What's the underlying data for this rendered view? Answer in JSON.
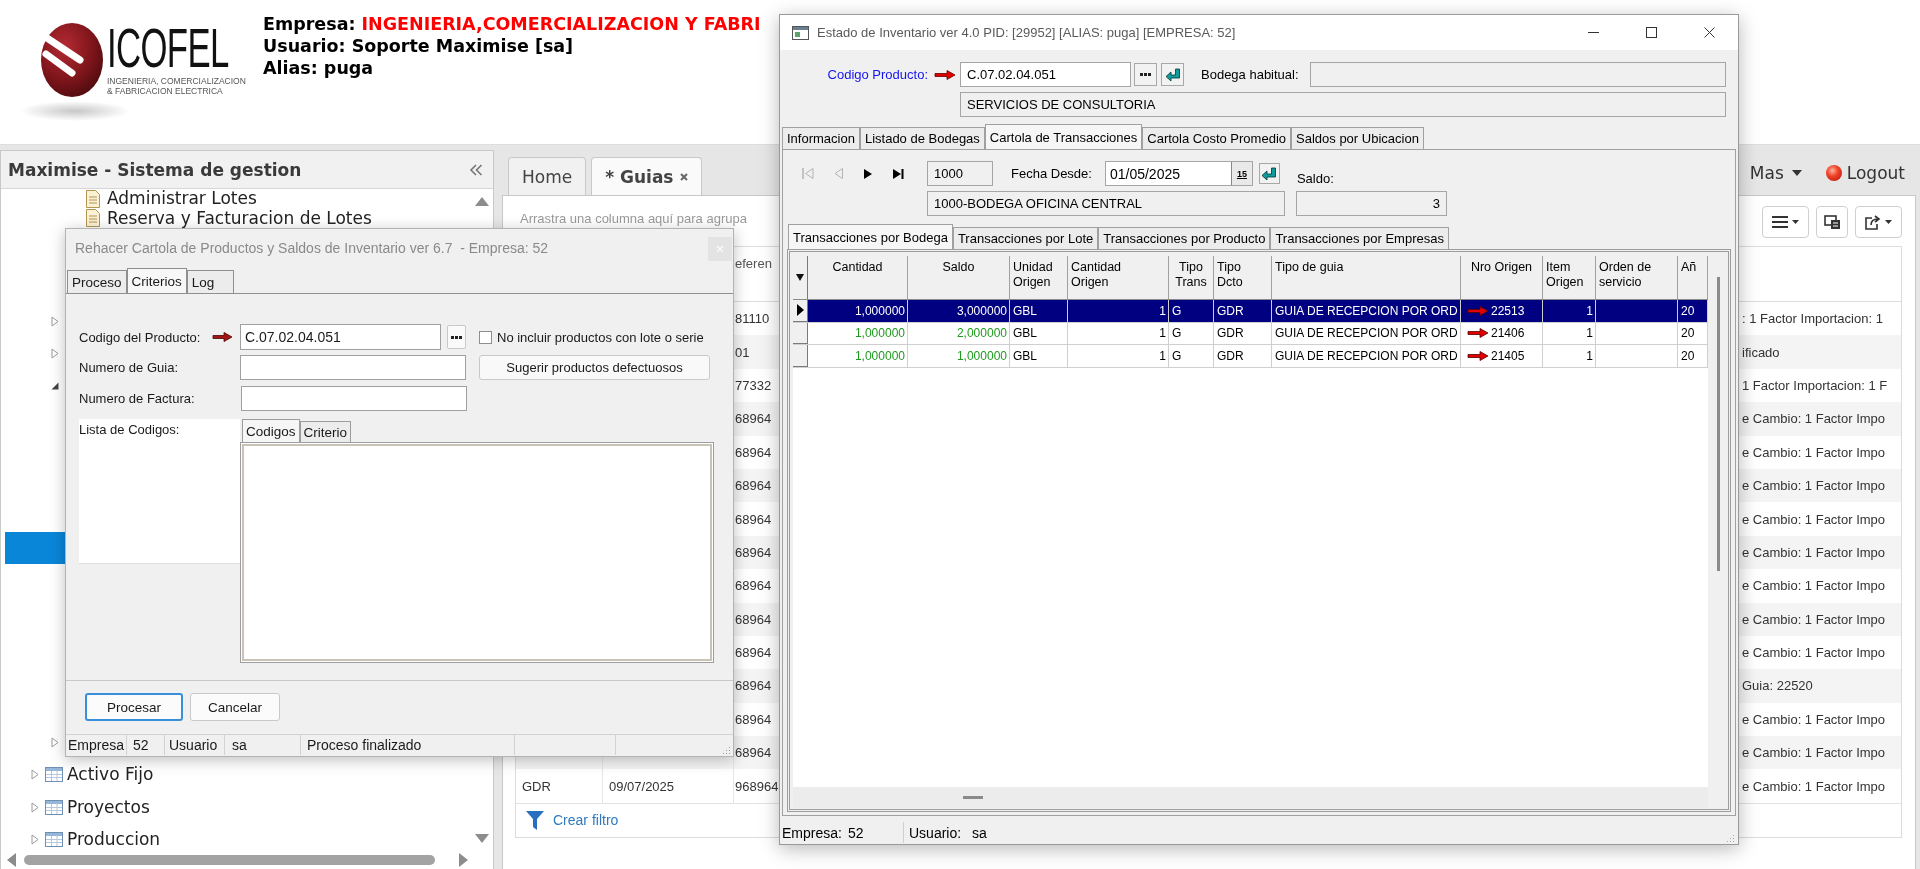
{
  "header": {
    "logo": {
      "name": "ICOFEL",
      "tagline": [
        "INGENIERIA, COMERCIALIZACION",
        "& FABRICACION ELECTRICA"
      ]
    },
    "lines": [
      {
        "label": "Empresa:",
        "value": "INGENIERIA,COMERCIALIZACION Y FABRI",
        "highlight": true
      },
      {
        "label": "Usuario:",
        "value": "Soporte Maximise [sa]",
        "highlight": false
      },
      {
        "label": "Alias:",
        "value": "puga",
        "highlight": false
      }
    ]
  },
  "sidebar": {
    "title": "Maximise - Sistema de gestion",
    "tree": [
      {
        "children": [
          {
            "children": [
              {
                "kind": "document",
                "label": "Administrar Lotes"
              },
              {
                "kind": "document",
                "label": "Reserva y Facturacion de Lotes"
              }
            ]
          },
          {
            "expanded": false
          },
          {
            "expanded": false
          },
          {
            "expanded": true,
            "children": [
              {
                "selected": true
              }
            ]
          },
          {
            "expanded": false
          }
        ]
      },
      {
        "kind": "module",
        "label": "Activo Fijo",
        "expanded": false
      },
      {
        "kind": "module",
        "label": "Proyectos",
        "expanded": false
      },
      {
        "kind": "module",
        "label": "Produccion",
        "expanded": false
      }
    ]
  },
  "main": {
    "tabs": [
      {
        "label": "Home",
        "selected": false,
        "closable": false
      },
      {
        "label": "* Guias",
        "selected": true,
        "closable": true
      }
    ],
    "more_menu": "Mas",
    "logout": "Logout",
    "grid": {
      "group_hint": "Arrastra una columna aquí para agrupa",
      "header_fragment": "eferen",
      "rows": [
        {
          "column_3": "81110",
          "column_5": ": 1 Factor Importacion: 1"
        },
        {
          "column_3": "01",
          "column_5": "ificado"
        },
        {
          "column_3": "77332",
          "column_5": "1 Factor Importacion: 1 F"
        },
        {
          "column_3": "68964",
          "column_5": "e Cambio: 1 Factor Impo"
        },
        {
          "column_3": "68964",
          "column_5": "e Cambio: 1 Factor Impo"
        },
        {
          "column_3": "68964",
          "column_5": "e Cambio: 1 Factor Impo"
        },
        {
          "column_3": "68964",
          "column_5": "e Cambio: 1 Factor Impo"
        },
        {
          "column_3": "68964",
          "column_5": "e Cambio: 1 Factor Impo"
        },
        {
          "column_3": "68964",
          "column_5": "e Cambio: 1 Factor Impo"
        },
        {
          "column_3": "68964",
          "column_5": "e Cambio: 1 Factor Impo"
        },
        {
          "column_3": "68964",
          "column_5": "e Cambio: 1 Factor Impo"
        },
        {
          "column_3": "68964",
          "column_5": "Guia: 22520"
        },
        {
          "column_3": "68964",
          "column_5": "e Cambio: 1 Factor Impo"
        },
        {
          "column_3": "68964",
          "column_5": "e Cambio: 1 Factor Impo"
        },
        {
          "column_1": "GDR",
          "column_2": "09/07/2025",
          "column_3": "968964",
          "column_5": "e Cambio: 1 Factor Impo"
        }
      ],
      "filter_link": "Crear filtro"
    }
  },
  "rebuild_dialog": {
    "title": "Rehacer Cartola de Productos y Saldos de Inventario ver 6.7  - Empresa: 52",
    "tabs": [
      {
        "label": "Proceso",
        "selected": false
      },
      {
        "label": "Criterios",
        "selected": true
      },
      {
        "label": "Log",
        "selected": false
      }
    ],
    "product_label": "Codigo del Producto:",
    "product_code": "C.07.02.04.051",
    "exclude_lots": {
      "label": "No incluir productos con lote o serie",
      "checked": false
    },
    "guide_label": "Numero de Guia:",
    "suggest_button": "Sugerir productos defectuosos",
    "invoice_label": "Numero de Factura:",
    "codes_label": "Lista de Codigos:",
    "codes_tabs": [
      {
        "label": "Codigos",
        "selected": true
      },
      {
        "label": "Criterio",
        "selected": false
      }
    ],
    "buttons": [
      {
        "label": "Procesar",
        "focused": true
      },
      {
        "label": "Cancelar",
        "focused": false
      }
    ],
    "status_bar": [
      {
        "label": "Empresa",
        "value": "52"
      },
      {
        "label": "Usuario",
        "value": "sa"
      }
    ],
    "status_message": "Proceso finalizado"
  },
  "inventory_window": {
    "title": "Estado de Inventario ver 4.0 PID: [29952] [ALIAS: puga] [EMPRESA: 52]",
    "product_label": "Codigo Producto:",
    "product_code": "C.07.02.04.051",
    "warehouse_label": "Bodega habitual:",
    "description": "SERVICIOS DE CONSULTORIA",
    "tabs": [
      {
        "label": "Informacion",
        "selected": false
      },
      {
        "label": "Listado de Bodegas",
        "selected": false
      },
      {
        "label": "Cartola de Transacciones",
        "selected": true
      },
      {
        "label": "Cartola Costo Promedio",
        "selected": false
      },
      {
        "label": "Saldos por Ubicacion",
        "selected": false
      }
    ],
    "nav_buttons": [
      {
        "kind": "first",
        "disabled": true
      },
      {
        "kind": "previous",
        "disabled": true
      },
      {
        "kind": "next",
        "disabled": false
      },
      {
        "kind": "last",
        "disabled": false
      }
    ],
    "warehouse_code": "1000",
    "date_label": "Fecha Desde:",
    "date": "01/05/2025",
    "calendar_button": "15",
    "balance_label": "Saldo:",
    "warehouse_name": "1000-BODEGA OFICINA CENTRAL",
    "balance": "3",
    "subtabs": [
      {
        "label": "Transacciones por Bodega",
        "selected": true
      },
      {
        "label": "Transacciones por Lote",
        "selected": false
      },
      {
        "label": "Transacciones por Producto",
        "selected": false
      },
      {
        "label": "Transacciones por Empresas",
        "selected": false
      }
    ],
    "grid": {
      "columns": [
        {
          "label": "Cantidad",
          "kind": "quantity"
        },
        {
          "label": "Saldo",
          "kind": "quantity"
        },
        {
          "label": "Unidad Origen",
          "kind": "text"
        },
        {
          "label": "Cantidad Origen",
          "kind": "number"
        },
        {
          "label": "Tipo Trans",
          "kind": "text"
        },
        {
          "label": "Tipo Dcto",
          "kind": "text"
        },
        {
          "label": "Tipo de guia",
          "kind": "text"
        },
        {
          "label": "Nro Origen",
          "kind": "link"
        },
        {
          "label": "Item Origen",
          "kind": "number"
        },
        {
          "label": "Orden de servicio"
        },
        {
          "label": "Añ",
          "kind": "text"
        }
      ],
      "rows": [
        {
          "selected": true,
          "cells": [
            "1,000000",
            "3,000000",
            "GBL",
            "1",
            "G",
            "GDR",
            "GUIA DE RECEPCION POR ORD",
            "22513",
            "1",
            null,
            "20"
          ]
        },
        {
          "selected": false,
          "cells": [
            "1,000000",
            "2,000000",
            "GBL",
            "1",
            "G",
            "GDR",
            "GUIA DE RECEPCION POR ORD",
            "21406",
            "1",
            null,
            "20"
          ]
        },
        {
          "selected": false,
          "cells": [
            "1,000000",
            "1,000000",
            "GBL",
            "1",
            "G",
            "GDR",
            "GUIA DE RECEPCION POR ORD",
            "21405",
            "1",
            null,
            "20"
          ]
        }
      ]
    },
    "status_bar": [
      {
        "label": "Empresa:",
        "value": "52"
      },
      {
        "label": "Usuario:",
        "value": "sa"
      }
    ]
  }
}
